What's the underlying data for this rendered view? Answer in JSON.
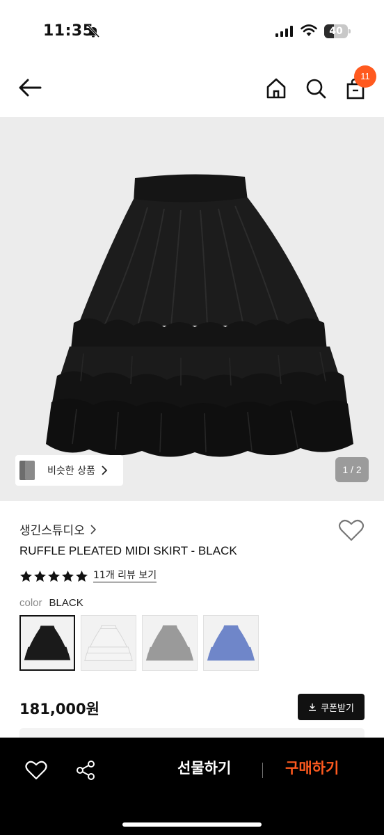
{
  "status_bar": {
    "time": "11:35",
    "battery": "40",
    "battery_level": 0.4
  },
  "header": {
    "cart_count": "11",
    "icons": [
      "back-arrow-icon",
      "home-icon",
      "search-icon",
      "shopping-bag-icon"
    ],
    "badge_color": "#ff5a1f"
  },
  "gallery": {
    "similar_label": "비슷한 상품",
    "counter": "1 / 2"
  },
  "product": {
    "brand": "생긴스튜디오",
    "title": "RUFFLE PLEATED MIDI SKIRT - BLACK",
    "rating_stars": 5,
    "review_link": "11개 리뷰 보기",
    "color_label": "color",
    "color_value": "BLACK",
    "swatch_colors": [
      "#1a1a1a",
      "#f4f4f4",
      "#9a9a9a",
      "#6f86c9"
    ],
    "price": "181,000원",
    "coupon_label": "쿠폰받기"
  },
  "bottom_bar": {
    "gift_label": "선물하기",
    "buy_label": "구매하기",
    "buy_color": "#ff5a1f",
    "icons": [
      "heart-icon",
      "share-icon"
    ]
  }
}
